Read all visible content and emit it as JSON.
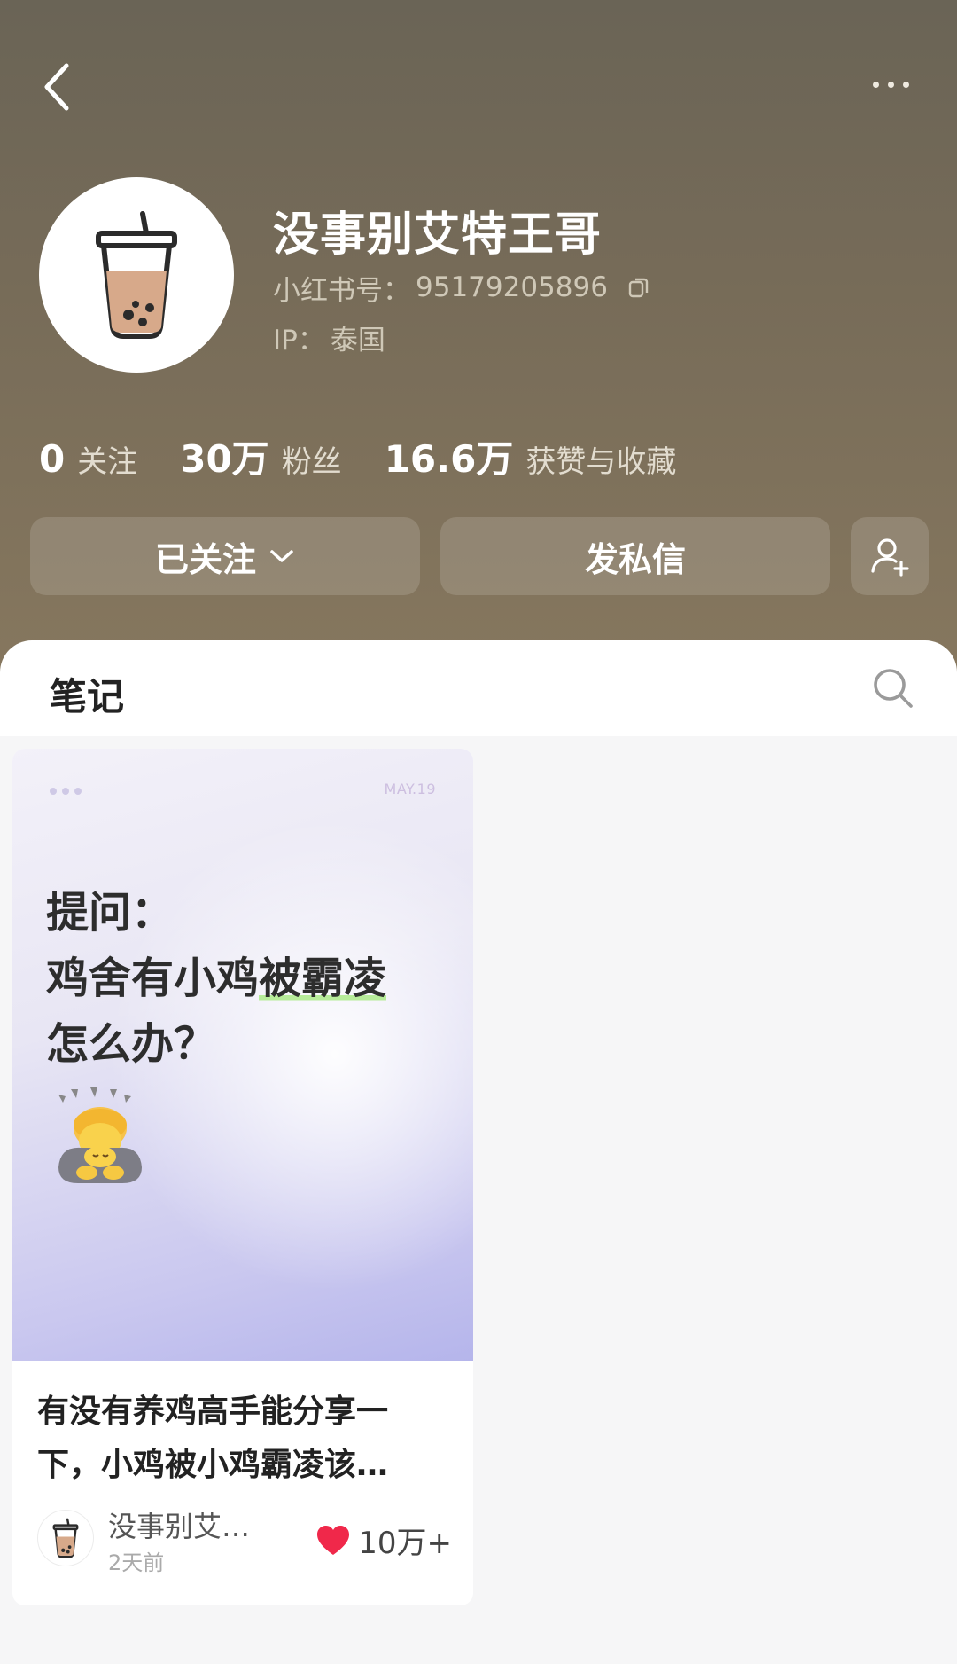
{
  "profile": {
    "nickname": "没事别艾特王哥",
    "account_label": "小红书号：",
    "account_id": "95179205896",
    "ip_label": "IP：",
    "ip_value": "泰国"
  },
  "stats": [
    {
      "value": "0",
      "label": "关注"
    },
    {
      "value": "30万",
      "label": "粉丝"
    },
    {
      "value": "16.6万",
      "label": "获赞与收藏"
    }
  ],
  "actions": {
    "follow_label": "已关注",
    "message_label": "发私信"
  },
  "tabs": {
    "notes_label": "笔记"
  },
  "note": {
    "cover_date": "MAY.19",
    "cover_line1": "提问：",
    "cover_line2_plain": "鸡舍有小鸡",
    "cover_line2_highlight": "被霸凌",
    "cover_line3": "怎么办？",
    "title": "有没有养鸡高手能分享一下，小鸡被小鸡霸凌该…",
    "author": "没事别艾…",
    "time": "2天前",
    "likes": "10万+"
  },
  "colors": {
    "header_top": "#6a6456",
    "header_bottom": "#86775e",
    "like_red": "#f0284a",
    "highlight_green": "#b7ec9a"
  },
  "icons": [
    "back-icon",
    "more-icon",
    "copy-icon",
    "chevron-down-icon",
    "add-user-icon",
    "search-icon",
    "heart-icon",
    "bubble-tea-icon"
  ]
}
